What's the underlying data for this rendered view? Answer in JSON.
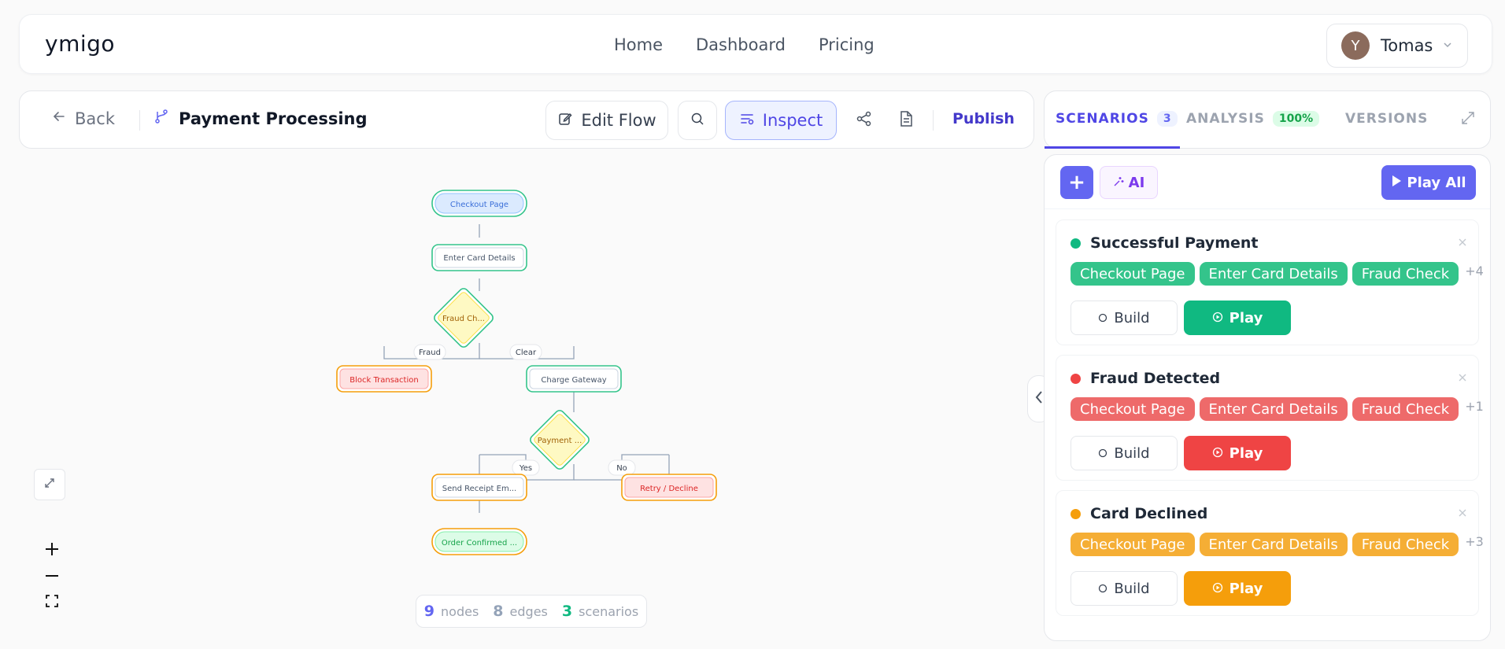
{
  "brand": "ymigo",
  "nav": {
    "links": [
      "Home",
      "Dashboard",
      "Pricing"
    ]
  },
  "user": {
    "initial": "Y",
    "name": "Tomas"
  },
  "toolbar": {
    "back_label": "Back",
    "flow_title": "Payment Processing",
    "edit_label": "Edit Flow",
    "inspect_label": "Inspect",
    "publish_label": "Publish"
  },
  "flow": {
    "nodes": [
      {
        "id": "checkout",
        "label": "Checkout Page",
        "kind": "start"
      },
      {
        "id": "card",
        "label": "Enter Card Details",
        "kind": "step"
      },
      {
        "id": "fraud",
        "label": "Fraud Ch...",
        "kind": "decision"
      },
      {
        "id": "block",
        "label": "Block Transaction",
        "kind": "error"
      },
      {
        "id": "charge",
        "label": "Charge Gateway",
        "kind": "step"
      },
      {
        "id": "payment",
        "label": "Payment ...",
        "kind": "decision"
      },
      {
        "id": "receipt",
        "label": "Send Receipt Em...",
        "kind": "warn"
      },
      {
        "id": "retry",
        "label": "Retry / Decline",
        "kind": "error"
      },
      {
        "id": "confirmed",
        "label": "Order Confirmed ...",
        "kind": "success"
      }
    ],
    "edge_labels": {
      "fraud": "Fraud",
      "clear": "Clear",
      "yes": "Yes",
      "no": "No"
    }
  },
  "stats": {
    "nodes_count": "9",
    "nodes_label": "nodes",
    "edges_count": "8",
    "edges_label": "edges",
    "scenarios_count": "3",
    "scenarios_label": "scenarios"
  },
  "panel": {
    "tabs": [
      {
        "label": "SCENARIOS",
        "badge": "3"
      },
      {
        "label": "ANALYSIS",
        "badge": "100%"
      },
      {
        "label": "VERSIONS"
      }
    ],
    "ai_label": "AI",
    "play_all_label": "Play All",
    "build_label": "Build",
    "play_label": "Play",
    "scenarios": [
      {
        "name": "Successful Payment",
        "color": "#10b981",
        "tag_color": "#34c48b",
        "btn_color": "#10b981",
        "tags": [
          "Checkout Page",
          "Enter Card Details",
          "Fraud Check"
        ],
        "more": "+4"
      },
      {
        "name": "Fraud Detected",
        "color": "#ef4444",
        "tag_color": "#ee6a6a",
        "btn_color": "#ef4444",
        "tags": [
          "Checkout Page",
          "Enter Card Details",
          "Fraud Check"
        ],
        "more": "+1"
      },
      {
        "name": "Card Declined",
        "color": "#f59e0b",
        "tag_color": "#f5ae35",
        "btn_color": "#f59e0b",
        "tags": [
          "Checkout Page",
          "Enter Card Details",
          "Fraud Check"
        ],
        "more": "+3"
      }
    ]
  }
}
